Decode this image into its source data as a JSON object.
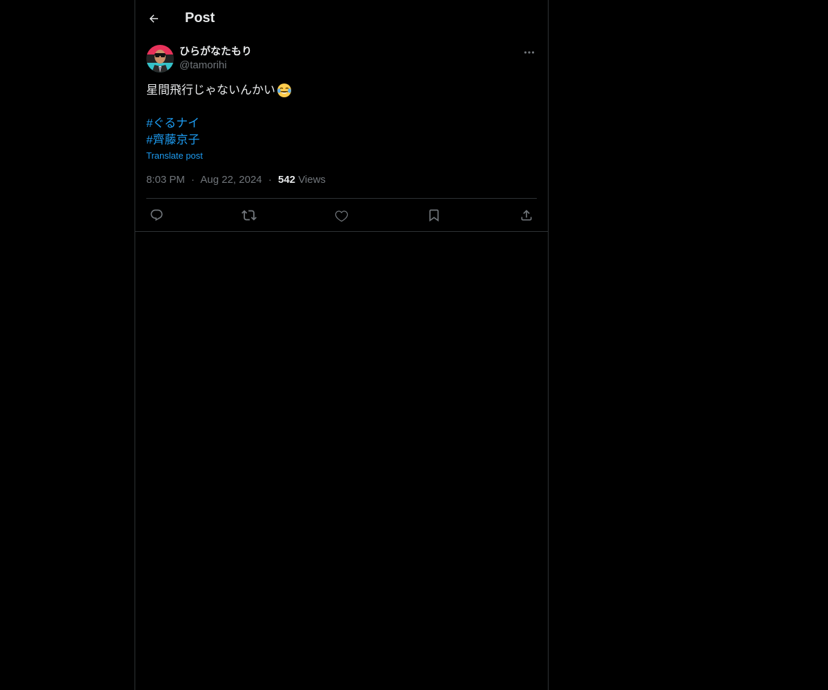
{
  "header": {
    "title": "Post",
    "back_icon": "arrow-left-icon"
  },
  "post": {
    "author": {
      "display_name": "ひらがなたもり",
      "handle": "@tamorihi",
      "avatar_icon": "profile-avatar"
    },
    "text": "星間飛行じゃないんかい",
    "emoji": "face-with-tears-of-joy",
    "hashtags": [
      "#ぐるナイ",
      "#齊藤京子"
    ],
    "translate_label": "Translate post",
    "time": "8:03 PM",
    "date": "Aug 22, 2024",
    "views_count": "542",
    "views_label": "Views",
    "separator": "·"
  },
  "actions": {
    "reply_icon": "reply-icon",
    "repost_icon": "repost-icon",
    "like_icon": "heart-icon",
    "bookmark_icon": "bookmark-icon",
    "share_icon": "share-icon"
  },
  "colors": {
    "background": "#000000",
    "text_primary": "#e7e9ea",
    "text_secondary": "#71767b",
    "accent": "#1d9bf0",
    "border": "#2f3336"
  }
}
